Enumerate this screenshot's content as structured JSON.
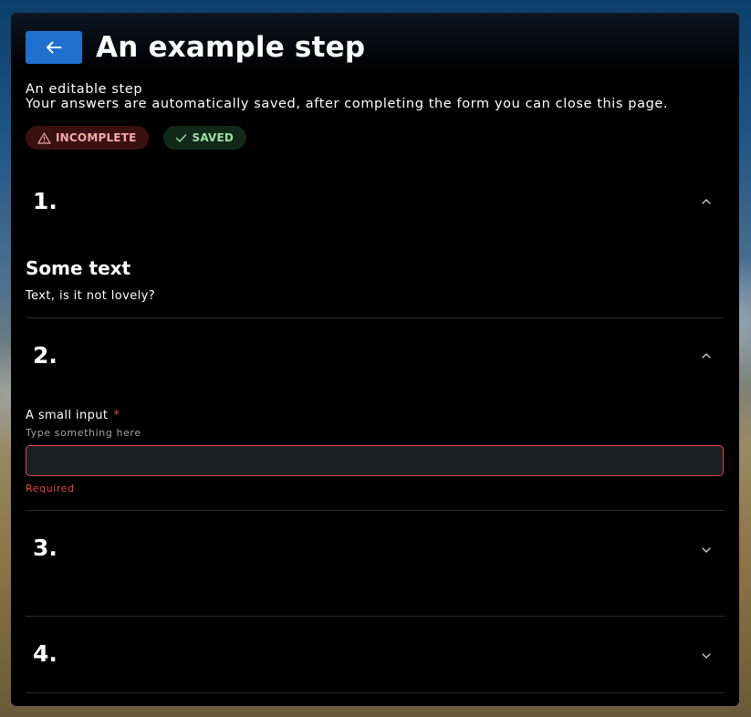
{
  "header": {
    "title": "An example step",
    "back_icon": "arrow-left-icon"
  },
  "subtitle": {
    "line1": "An editable step",
    "line2": "Your answers are automatically saved, after completing the form you can close this page."
  },
  "badges": {
    "incomplete": {
      "label": "INCOMPLETE",
      "icon": "warning-icon",
      "color": "#f2a9aa"
    },
    "saved": {
      "label": "SAVED",
      "icon": "check-icon",
      "color": "#9ddfa5"
    }
  },
  "sections": [
    {
      "number": "1.",
      "expanded": true,
      "heading": "Some text",
      "text": "Text, is it not lovely?"
    },
    {
      "number": "2.",
      "expanded": true,
      "field": {
        "label": "A small input",
        "required_mark": "*",
        "hint": "Type something here",
        "value": "",
        "error": "Required"
      }
    },
    {
      "number": "3.",
      "expanded": false
    },
    {
      "number": "4.",
      "expanded": false
    }
  ],
  "colors": {
    "accent": "#1f6fce",
    "error": "#e0484a",
    "card_background": "#000000"
  }
}
